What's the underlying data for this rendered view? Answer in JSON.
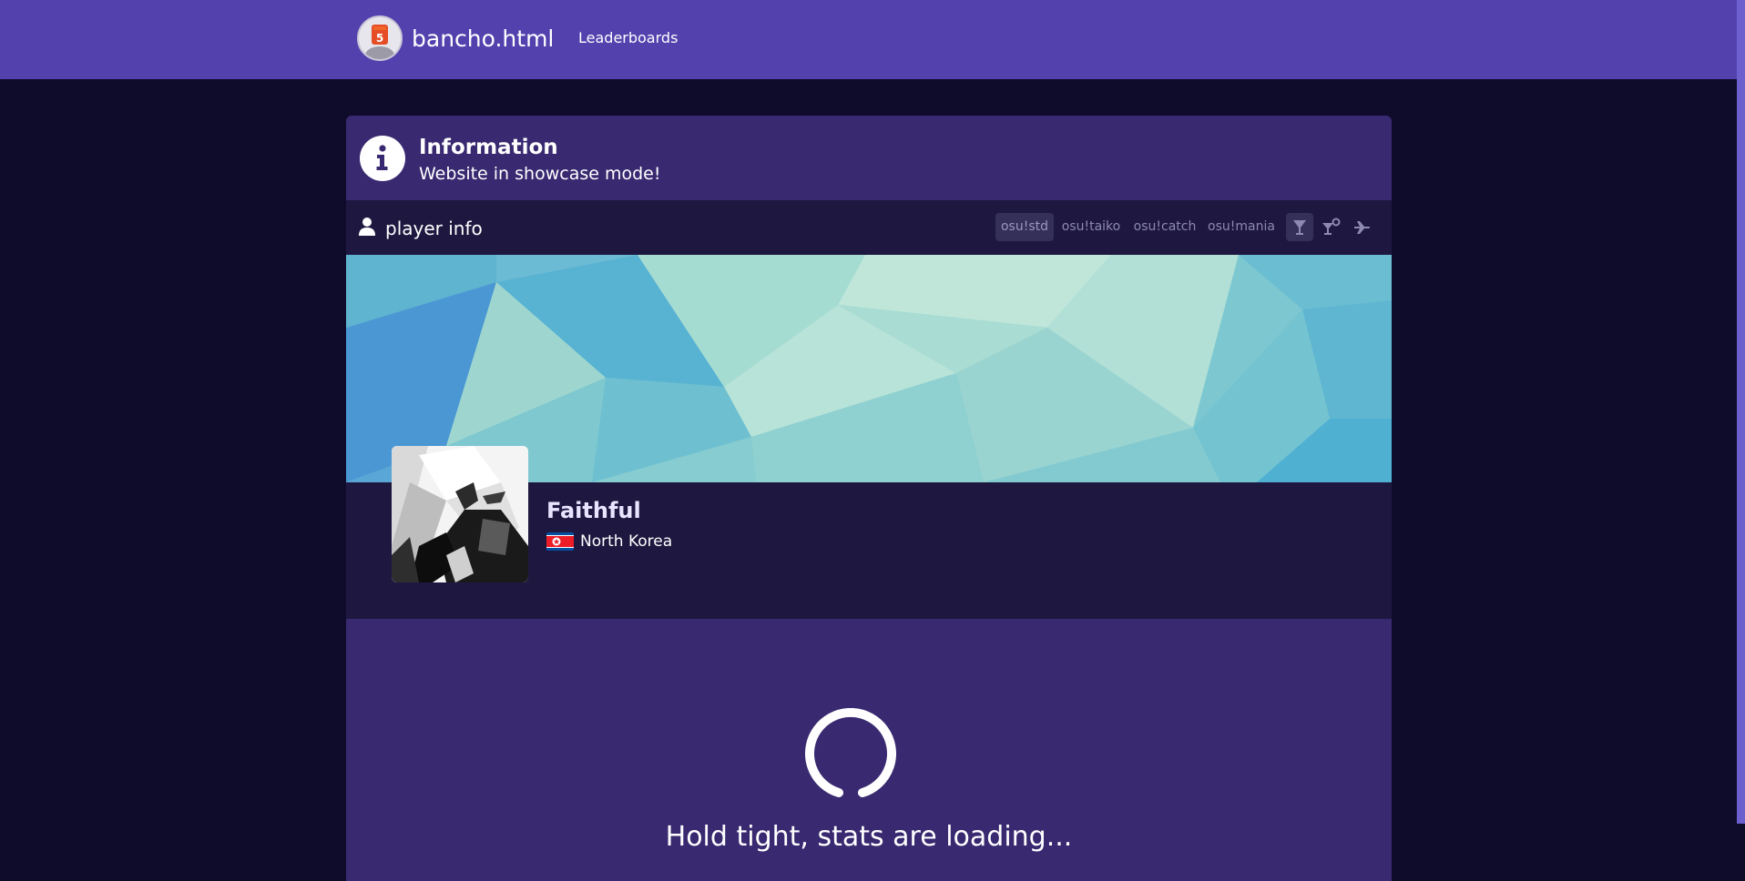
{
  "nav": {
    "brand": "bancho.html",
    "links": [
      "Leaderboards"
    ]
  },
  "info": {
    "title": "Information",
    "message": "Website in showcase mode!"
  },
  "player_info": {
    "title": "player info",
    "modes": [
      "osu!std",
      "osu!taiko",
      "osu!catch",
      "osu!mania"
    ],
    "active_mode": "osu!std",
    "mods": [
      "vanilla-icon",
      "relax-icon",
      "autopilot-icon"
    ],
    "active_mod": "vanilla-icon"
  },
  "profile": {
    "username": "Faithful",
    "country": "North Korea"
  },
  "loading": {
    "text": "Hold tight, stats are loading..."
  },
  "colors": {
    "navbar": "#5341ae",
    "page_background": "#0f0b2b",
    "panel": "#382970",
    "header": "#1e1840",
    "username": "#e9e4ff"
  }
}
